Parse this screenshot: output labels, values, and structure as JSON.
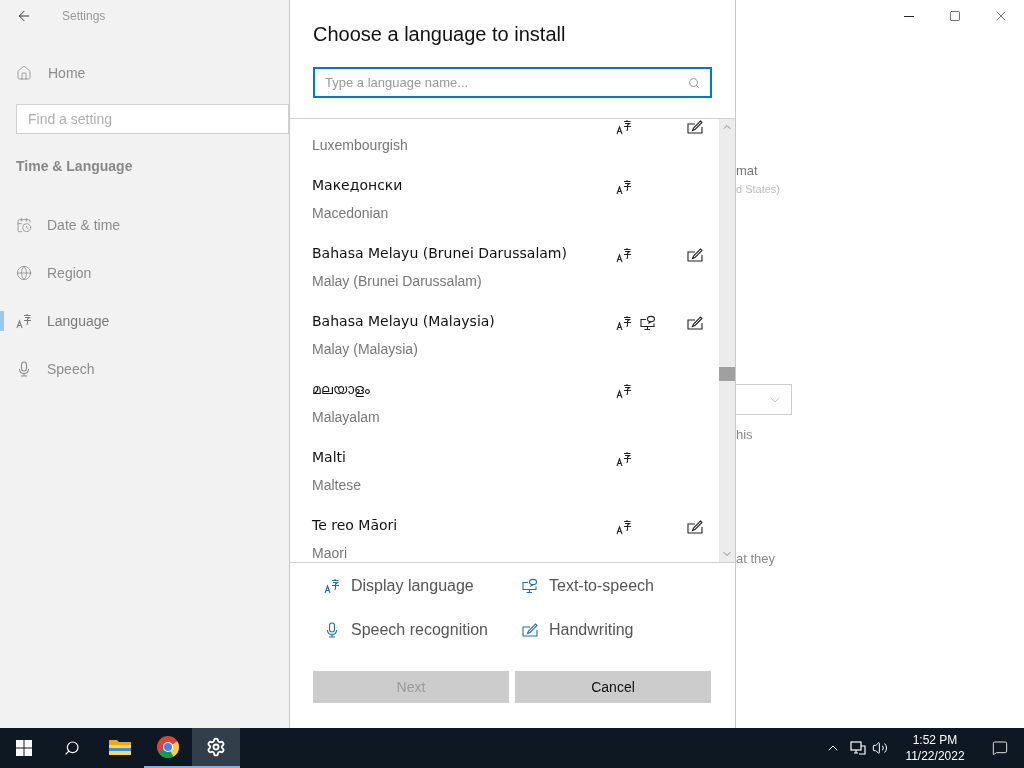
{
  "settings": {
    "title": "Settings",
    "home": "Home",
    "search": {
      "placeholder": "Find a setting"
    },
    "section": "Time & Language",
    "nav": [
      {
        "kind": "date",
        "label": "Date & time",
        "selected": false
      },
      {
        "kind": "region",
        "label": "Region",
        "selected": false
      },
      {
        "kind": "language",
        "label": "Language",
        "selected": true
      },
      {
        "kind": "speech",
        "label": "Speech",
        "selected": false
      }
    ]
  },
  "content": {
    "text_1": "mat",
    "text_2": "d States)",
    "text_3": "his",
    "text_4": "at they"
  },
  "dialog": {
    "title": "Choose a language to install",
    "search": {
      "placeholder": "Type a language name..."
    },
    "languages": [
      {
        "english": "Luxembourgish",
        "display": true,
        "tts": false,
        "handwriting": true
      },
      {
        "native": "Македонски",
        "english": "Macedonian",
        "display": true,
        "tts": false,
        "handwriting": false
      },
      {
        "native": "Bahasa Melayu (Brunei Darussalam)",
        "english": "Malay (Brunei Darussalam)",
        "display": true,
        "tts": false,
        "handwriting": true
      },
      {
        "native": "Bahasa Melayu (Malaysia)",
        "english": "Malay (Malaysia)",
        "display": true,
        "tts": true,
        "handwriting": true
      },
      {
        "native": "മലയാളം",
        "english": "Malayalam",
        "display": true,
        "tts": false,
        "handwriting": false
      },
      {
        "native": "Malti",
        "english": "Maltese",
        "display": true,
        "tts": false,
        "handwriting": false
      },
      {
        "native": "Te reo Māori",
        "english": "Maori",
        "display": true,
        "tts": false,
        "handwriting": true
      }
    ],
    "legend": [
      {
        "kind": "display",
        "label": "Display language"
      },
      {
        "kind": "tts",
        "label": "Text-to-speech"
      },
      {
        "kind": "speech",
        "label": "Speech recognition"
      },
      {
        "kind": "handwriting",
        "label": "Handwriting"
      }
    ],
    "buttons": [
      {
        "label": "Next",
        "disabled": true
      },
      {
        "label": "Cancel",
        "disabled": false
      }
    ]
  },
  "taskbar": {
    "pinned": [
      {
        "kind": "explorer",
        "running": false,
        "selected": false
      },
      {
        "kind": "chrome",
        "running": true,
        "selected": false
      },
      {
        "kind": "settings",
        "running": true,
        "selected": true
      }
    ],
    "time": "1:52 PM",
    "date": "11/22/2022"
  }
}
